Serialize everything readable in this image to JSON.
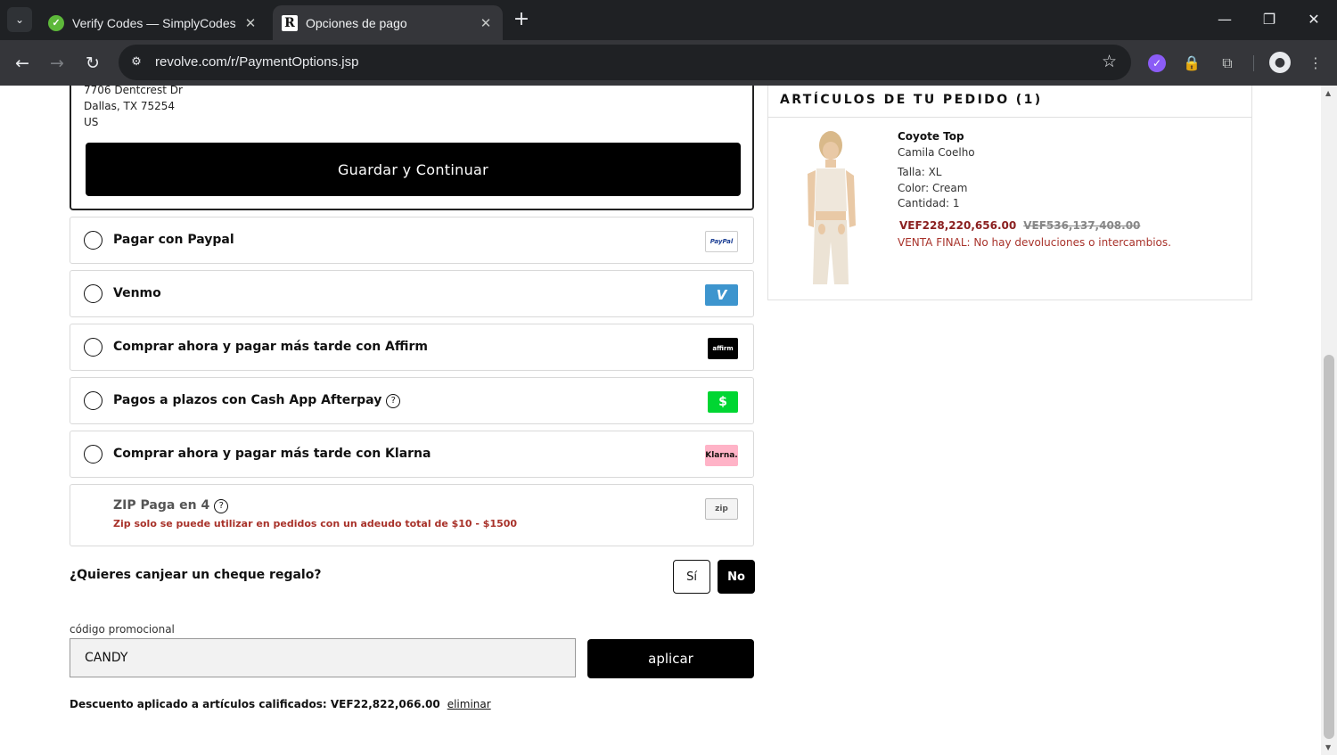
{
  "browser": {
    "tabs": [
      {
        "title": "Verify Codes — SimplyCodes",
        "active": false
      },
      {
        "title": "Opciones de pago",
        "active": true
      }
    ],
    "url": "revolve.com/r/PaymentOptions.jsp"
  },
  "address": {
    "line1": "7706 Dentcrest Dr",
    "line2": "Dallas, TX 75254",
    "line3": "US",
    "save_label": "Guardar y Continuar"
  },
  "payment_options": [
    {
      "label": "Pagar con Paypal",
      "logo": "PayPal",
      "has_help": false
    },
    {
      "label": "Venmo",
      "logo": "V",
      "has_help": false
    },
    {
      "label": "Comprar ahora y pagar más tarde con Affirm",
      "logo": "affirm",
      "has_help": false
    },
    {
      "label": "Pagos a plazos con Cash App Afterpay",
      "logo": "$",
      "has_help": true
    },
    {
      "label": "Comprar ahora y pagar más tarde con Klarna",
      "logo": "Klarna.",
      "has_help": false
    }
  ],
  "zip": {
    "title": "ZIP Paga en 4",
    "note": "Zip solo se puede utilizar en pedidos con un adeudo total de $10 - $1500",
    "logo": "zip"
  },
  "gift": {
    "question": "¿Quieres canjear un cheque regalo?",
    "yes_label": "Sí",
    "no_label": "No"
  },
  "promo": {
    "label": "código promocional",
    "value": "CANDY",
    "apply_label": "aplicar",
    "discount_text": "Descuento aplicado a artículos calificados: VEF22,822,066.00",
    "remove_label": "eliminar"
  },
  "order": {
    "title": "ARTÍCULOS DE TU PEDIDO (1)",
    "product_name": "Coyote Top",
    "brand": "Camila Coelho",
    "size": "Talla:  XL",
    "color": "Color:  Cream",
    "quantity": "Cantidad:  1",
    "price": "VEF228,220,656.00",
    "old_price": "VEF536,137,408.00",
    "final_sale": "VENTA FINAL: No hay devoluciones o intercambios."
  },
  "colors": {
    "accent": "#000000",
    "sale_red": "#8b2020",
    "warning_red": "#a8322a",
    "chrome_dark": "#1f2124"
  }
}
